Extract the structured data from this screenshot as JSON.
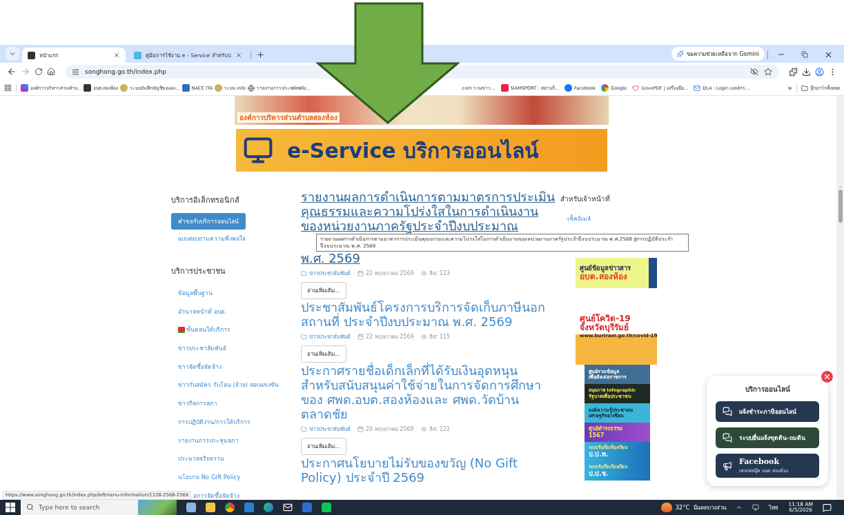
{
  "browser": {
    "tabs": [
      {
        "title": "หน้าแรก",
        "selected": true
      },
      {
        "title": "คู่มือการใช้งาน e – Service สำหรับป",
        "selected": false
      }
    ],
    "gemini_button": "ขอความช่วยเหลือจาก Gemini",
    "address": "songhong.go.th/index.php",
    "bookmarks_left": [
      {
        "label": "องค์การบริหารส่วนตำบ...",
        "kind": "org"
      },
      {
        "label": "อบต.สองห้อง",
        "kind": "joomla"
      },
      {
        "label": "ระบบบันทึกบัญชีขององ...",
        "kind": "seal"
      },
      {
        "label": "NACC ITA",
        "kind": "ita"
      },
      {
        "label": "ระบบ info",
        "kind": "seal"
      },
      {
        "label": "รายงานการประหยัดพลัง...",
        "kind": "globe"
      }
    ],
    "bookmarks_right": [
      {
        "label": ".com รวมข่าว...",
        "kind": "none"
      },
      {
        "label": "SIAMSPORT : สยามกี...",
        "kind": "siamsport"
      },
      {
        "label": "Facebook",
        "kind": "facebook"
      },
      {
        "label": "Google",
        "kind": "google"
      },
      {
        "label": "iLovePDF | เครื่องมือ...",
        "kind": "heart"
      },
      {
        "label": "DLA : Login  เมลล์กร...",
        "kind": "mail"
      }
    ],
    "more_bookmarks": "»",
    "all_bookmarks": "บุ๊กมาร์กทั้งหมด"
  },
  "site_banner": {
    "org_name": "องค์การบริหารส่วนตำบลสองห้อง",
    "eservice_title": "e-Service บริการออนไลน์"
  },
  "sidebar": {
    "sections": [
      {
        "heading": "บริการอิเล็กทรอนิกส์",
        "items": [
          {
            "label": "คำขอรับบริการออนไลน์",
            "selected": true,
            "icon": false
          },
          {
            "label": "แบบสอบถามความพึงพอใจ",
            "selected": false,
            "icon": false
          }
        ]
      },
      {
        "heading": "บริการประชาชน",
        "items": [
          {
            "label": "ข้อมูลพื้นฐาน",
            "selected": false,
            "icon": false
          },
          {
            "label": "อำนาจหน้าที่ อบต.",
            "selected": false,
            "icon": false
          },
          {
            "label": "ขั้นตอนให้บริการ",
            "selected": false,
            "icon": true
          },
          {
            "label": "ข่าวประชาสัมพันธ์",
            "selected": false,
            "icon": false
          },
          {
            "label": "ข่าวจัดซื้อจัดจ้าง",
            "selected": false,
            "icon": false
          },
          {
            "label": "ข่าวรับสมัคร รับโอน (ย้าย) สอบแข่งขัน",
            "selected": false,
            "icon": false
          },
          {
            "label": "ข่าวกิจการสภา",
            "selected": false,
            "icon": false
          },
          {
            "label": "การปฏิบัติงาน/การให้บริการ",
            "selected": false,
            "icon": false
          },
          {
            "label": "รายงานการประชุมสภา",
            "selected": false,
            "icon": false
          },
          {
            "label": "ประมวลจริยธรรม",
            "selected": false,
            "icon": false
          },
          {
            "label": "นโยบาย No Gift Policy",
            "selected": false,
            "icon": false
          },
          {
            "label": "อการจัดซื้อจัดจ้าง",
            "selected": false,
            "icon": false
          }
        ]
      }
    ]
  },
  "articles": [
    {
      "title_lines": [
        "รายงานผลการดำเนินการตามมาตรการประเมิน",
        "คุณธรรมและความโปร่งใสในการดำเนินงาน",
        "ของหน่วยงานภาครัฐประจำปีงบประมาณ",
        "พ.ศ. 2569"
      ],
      "hovered": true,
      "tooltip": "รายงานผลการดำเนินการตามมาตรการประเมินคุณธรรมและความโปร่งใสในการดำเนินงานของหน่วยงานภาครัฐประจำปีงบประมาณ พ.ศ.2568 สู่การปฏิบัติประจำปีงบประมาณ พ.ศ. 2569",
      "category": "ข่าวประชาสัมพันธ์",
      "date": "22 พฤษภาคม 2569",
      "hits": "ฮิต: 123",
      "read_more": "อ่านเพิ่มเติม..."
    },
    {
      "title_lines": [
        "ประชาสัมพันธ์โครงการบริการจัดเก็บภาษีนอก",
        "สถานที่ ประจำปีงบประมาณ พ.ศ. 2569"
      ],
      "hovered": false,
      "category": "ข่าวประชาสัมพันธ์",
      "date": "22 พฤษภาคม 2569",
      "hits": "ฮิต: 115",
      "read_more": "อ่านเพิ่มเติม..."
    },
    {
      "title_lines": [
        "ประกาศรายชื่อเด็กเล็กที่ได้รับเงินอุดหนุน",
        "สำหรับสนับสนุนค่าใช้จ่ายในการจัดการศึกษา",
        "ของ ศพด.อบต.สองห้องและ ศพด.วัดบ้าน",
        "ตลาดชัย"
      ],
      "hovered": false,
      "category": "ข่าวประชาสัมพันธ์",
      "date": "20 พฤษภาคม 2569",
      "hits": "ฮิต: 122",
      "read_more": "อ่านเพิ่มเติม..."
    },
    {
      "title_lines": [
        "ประกาศนโยบายไม่รับของขวัญ (No Gift",
        "Policy) ประจำปี 2569"
      ],
      "hovered": false
    }
  ],
  "staff": {
    "heading": "สำหรับเจ้าหน้าที่",
    "links": [
      "เช็คอีเมล์"
    ]
  },
  "banners": [
    {
      "kind": "info-center",
      "lines": [
        "ศูนย์ข้อมูลข่าวสาร",
        "อบต.สองห้อง"
      ]
    },
    {
      "kind": "covid",
      "lines": [
        "ศูนย์โควิด-19",
        "จังหวัดบุรีรัมย์",
        "www.buriram.go.th/covid-19"
      ]
    },
    {
      "kind": "gov-contact",
      "lines": [
        "ศูนย์รวมข้อมูล",
        "เพื่อติดต่อราชการ"
      ]
    },
    {
      "kind": "infographic",
      "lines": [
        "สมุดภาพ Infographic",
        "รัฐบาลเพื่อประชาชน"
      ]
    },
    {
      "kind": "asean",
      "lines": [
        "องค์ความรู้ประชาคม",
        "เศรษฐกิจอาเซียน"
      ]
    },
    {
      "kind": "damrongdhama",
      "lines": [
        "ศูนย์ดำรงธรรม",
        "1567"
      ]
    },
    {
      "kind": "complaint",
      "lines": [
        "ระบบรับเรื่องร้องเรียน",
        "ป.ป.ท."
      ]
    },
    {
      "kind": "complaint",
      "lines": [
        "ระบบรับเรื่องร้องเรียน",
        "ป.ป.ช."
      ]
    }
  ],
  "chat_widget": {
    "title": "บริการออนไลน์",
    "buttons": [
      {
        "kind": "chat",
        "label": "แจ้งชำระภาษีออนไลน์",
        "color": "#253850"
      },
      {
        "kind": "chat",
        "label": "ระบบยื่นแจ้งขุดดิน-ถมดิน",
        "color": "#2c4a37"
      },
      {
        "kind": "megaphone",
        "label": "Facebook",
        "sublabel": "เพจเฟสบุ๊ค อบต.สองห้อง",
        "color": "#253850"
      }
    ]
  },
  "status_url": "https://www.songhong.go.th/index.php/leftmenu-information/1128-2568-2569",
  "taskbar": {
    "search_placeholder": "Type here to search",
    "temperature": "32°C",
    "weather": "มีแดดบางส่วน",
    "language": "ไทย",
    "time": "11:18 AM",
    "date": "6/5/2026"
  }
}
